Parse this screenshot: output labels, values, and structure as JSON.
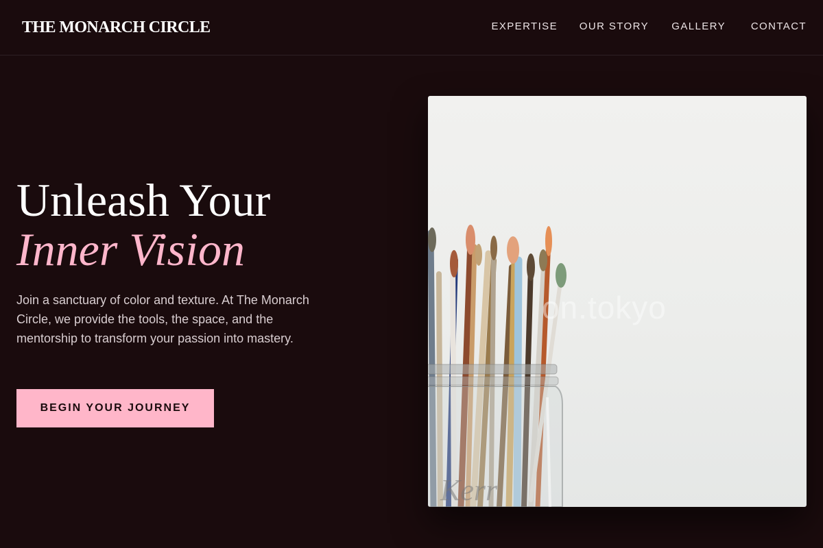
{
  "header": {
    "logo": "THE MONARCH CIRCLE",
    "nav": [
      {
        "label": "EXPERTISE"
      },
      {
        "label": "OUR STORY"
      },
      {
        "label": "GALLERY"
      },
      {
        "label": "CONTACT"
      }
    ]
  },
  "hero": {
    "title_line1": "Unleash Your",
    "title_line2": "Inner Vision",
    "description": "Join a sanctuary of color and texture. At The Monarch Circle, we provide the tools, the space, and the mentorship to transform your passion into mastery.",
    "cta_label": "BEGIN YOUR JOURNEY",
    "image_watermark": "on.tokyo"
  },
  "colors": {
    "background": "#1a0b0d",
    "accent": "#ffb6c9",
    "text": "#ffffff"
  }
}
